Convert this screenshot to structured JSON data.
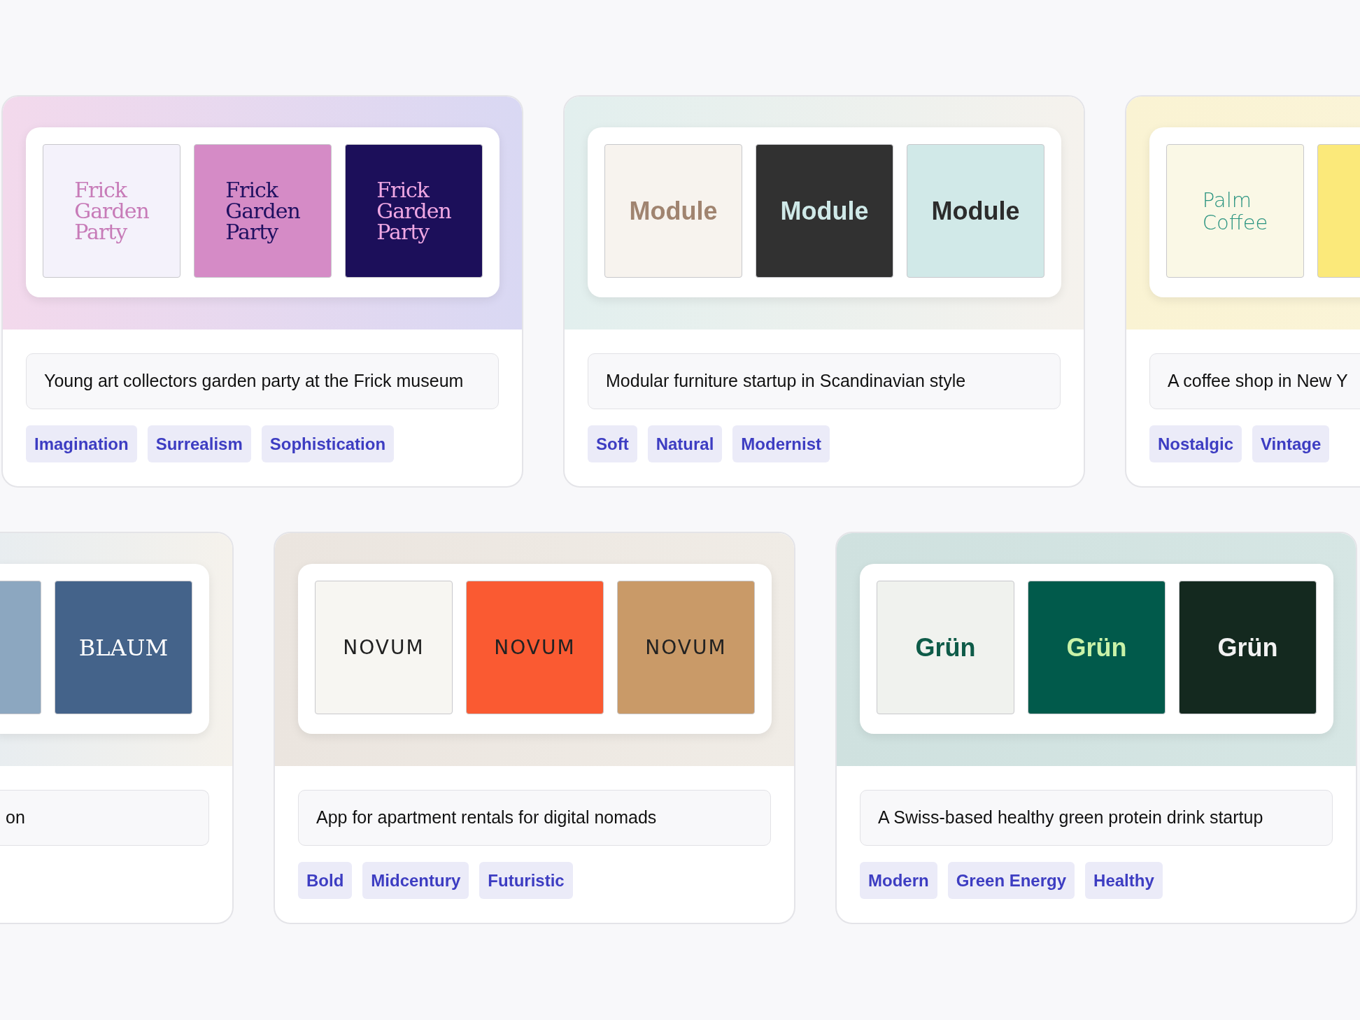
{
  "rows": [
    {
      "cards": [
        {
          "kind": "full",
          "gradient": [
            {
              "color": "#f3d9ec"
            },
            {
              "color": "#d9d8f3"
            }
          ],
          "swatches": [
            {
              "kind": "serif",
              "color": "#f4f2fb",
              "logo": {
                "text": "Frick\nGarden\nParty",
                "color": "#c77bb8"
              }
            },
            {
              "kind": "serif",
              "color": "#d58bc6",
              "logo": {
                "text": "Frick\nGarden\nParty",
                "color": "#1f1060"
              }
            },
            {
              "kind": "serif",
              "color": "#1c0f5a",
              "logo": {
                "text": "Frick\nGarden\nParty",
                "color": "#f0a8e3"
              }
            }
          ],
          "description": "Young art collectors garden party at the Frick museum",
          "tags": [
            "Imagination",
            "Surrealism",
            "Sophistication"
          ]
        },
        {
          "kind": "full",
          "gradient": [
            {
              "color": "#e2efee"
            },
            {
              "color": "#f5f2ed"
            }
          ],
          "swatches": [
            {
              "kind": "bold",
              "color": "#f7f3ee",
              "logo": {
                "text": "Module",
                "color": "#a08470"
              }
            },
            {
              "kind": "bold",
              "color": "#313131",
              "logo": {
                "text": "Module",
                "color": "#cfe9e8"
              }
            },
            {
              "kind": "bold",
              "color": "#d1e9e8",
              "logo": {
                "text": "Module",
                "color": "#2c2c2c"
              }
            }
          ],
          "description": "Modular furniture startup in Scandinavian style",
          "tags": [
            "Soft",
            "Natural",
            "Modernist"
          ]
        },
        {
          "kind": "full",
          "gradient": [
            {
              "color": "#faf3d3"
            },
            {
              "color": "#fbf5dc"
            }
          ],
          "swatches": [
            {
              "kind": "light",
              "color": "#faf8e6",
              "logo": {
                "text": "Palm\nCoffee",
                "color": "#2b9480"
              }
            },
            {
              "kind": "partial",
              "color": "#fbe97a"
            }
          ],
          "description": "A coffee shop in New Y",
          "tags": [
            "Nostalgic",
            "Vintage"
          ]
        }
      ]
    },
    {
      "cards": [
        {
          "kind": "cut-left",
          "gradient": [
            {
              "color": "#e8edf0"
            },
            {
              "color": "#f5f2ec"
            }
          ],
          "swatches": [
            {
              "kind": "partial",
              "color": "#8ca7c0"
            },
            {
              "kind": "caps",
              "color": "#44638a",
              "logo": {
                "text": "BLAUM",
                "color": "#ffffff"
              }
            }
          ],
          "description": "on"
        },
        {
          "kind": "full",
          "gradient": [
            {
              "color": "#ebe5df"
            },
            {
              "color": "#f0ece6"
            }
          ],
          "swatches": [
            {
              "kind": "wide",
              "color": "#f7f6f2",
              "logo": {
                "text": "NOVUM",
                "color": "#222222"
              }
            },
            {
              "kind": "wide",
              "color": "#fa5a32",
              "logo": {
                "text": "NOVUM",
                "color": "#222222"
              }
            },
            {
              "kind": "wide",
              "color": "#c99a68",
              "logo": {
                "text": "NOVUM",
                "color": "#222222"
              }
            }
          ],
          "description": "App for apartment rentals for digital nomads",
          "tags": [
            "Bold",
            "Midcentury",
            "Futuristic"
          ]
        },
        {
          "kind": "full",
          "gradient": [
            {
              "color": "#cfe1df"
            },
            {
              "color": "#d6e6e4"
            }
          ],
          "swatches": [
            {
              "kind": "bold",
              "color": "#f0f2ee",
              "logo": {
                "text": "Grün",
                "color": "#0e5b48"
              }
            },
            {
              "kind": "bold",
              "color": "#015a4b",
              "logo": {
                "text": "Grün",
                "color": "#c9f2a8"
              }
            },
            {
              "kind": "bold",
              "color": "#14291f",
              "logo": {
                "text": "Grün",
                "color": "#f2f2f2"
              }
            }
          ],
          "description": "A Swiss-based healthy green protein drink startup",
          "tags": [
            "Modern",
            "Green Energy",
            "Healthy"
          ]
        }
      ]
    }
  ]
}
